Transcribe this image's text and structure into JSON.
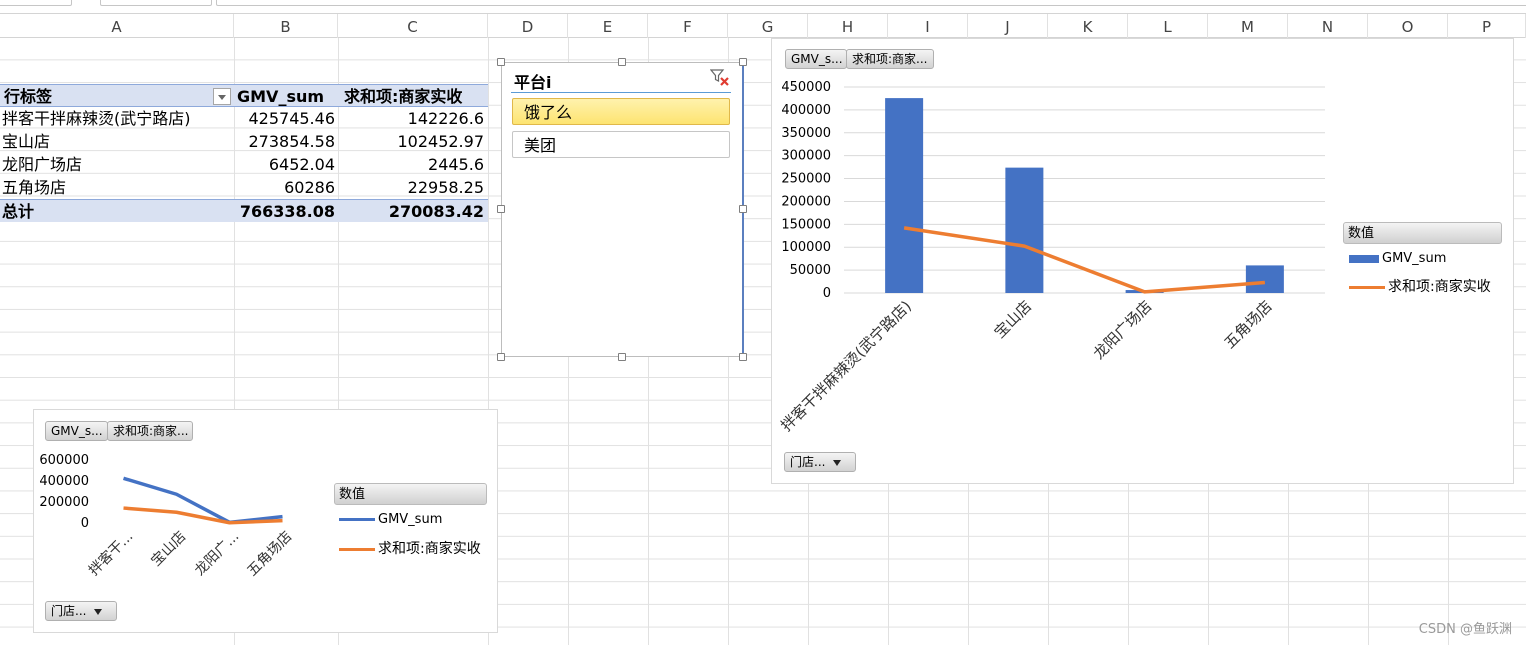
{
  "columns": [
    "A",
    "B",
    "C",
    "D",
    "E",
    "F",
    "G",
    "H",
    "I",
    "J",
    "K",
    "L",
    "M",
    "N",
    "O",
    "P"
  ],
  "pivot": {
    "header": {
      "row_label": "行标签",
      "col_b": "GMV_sum",
      "col_c": "求和项:商家实收"
    },
    "rows": [
      {
        "label": "拌客干拌麻辣烫(武宁路店)",
        "gmv": "425745.46",
        "income": "142226.6"
      },
      {
        "label": "宝山店",
        "gmv": "273854.58",
        "income": "102452.97"
      },
      {
        "label": "龙阳广场店",
        "gmv": "6452.04",
        "income": "2445.6"
      },
      {
        "label": "五角场店",
        "gmv": "60286",
        "income": "22958.25"
      }
    ],
    "total": {
      "label": "总计",
      "gmv": "766338.08",
      "income": "270083.42"
    }
  },
  "slicer": {
    "title": "平台i",
    "items": [
      {
        "label": "饿了么",
        "selected": true
      },
      {
        "label": "美团",
        "selected": false
      }
    ]
  },
  "chart_data": [
    {
      "type": "bar",
      "categories": [
        "拌客干拌麻辣烫(武宁路店)",
        "宝山店",
        "龙阳广场店",
        "五角场店"
      ],
      "series": [
        {
          "name": "GMV_sum",
          "kind": "bar",
          "color": "#4472c4",
          "values": [
            425745.46,
            273854.58,
            6452.04,
            60286
          ]
        },
        {
          "name": "求和项:商家实收",
          "kind": "line",
          "color": "#ed7d31",
          "values": [
            142226.6,
            102452.97,
            2445.6,
            22958.25
          ]
        }
      ],
      "yticks": [
        "450000",
        "400000",
        "350000",
        "300000",
        "250000",
        "200000",
        "150000",
        "100000",
        "50000",
        "0"
      ],
      "ylim": [
        0,
        450000
      ],
      "grid": true,
      "legend_title": "数值",
      "legend_position": "right",
      "field_buttons": [
        "GMV_s...",
        "求和项:商家..."
      ],
      "axis_field_button": "门店..."
    },
    {
      "type": "line",
      "categories": [
        "拌客干...",
        "宝山店",
        "龙阳广...",
        "五角场店"
      ],
      "series": [
        {
          "name": "GMV_sum",
          "color": "#4472c4",
          "values": [
            425745.46,
            273854.58,
            6452.04,
            60286
          ]
        },
        {
          "name": "求和项:商家实收",
          "color": "#ed7d31",
          "values": [
            142226.6,
            102452.97,
            2445.6,
            22958.25
          ]
        }
      ],
      "yticks": [
        "600000",
        "400000",
        "200000",
        "0"
      ],
      "ylim": [
        0,
        600000
      ],
      "grid": false,
      "legend_title": "数值",
      "legend_position": "right",
      "field_buttons": [
        "GMV_s...",
        "求和项:商家..."
      ],
      "axis_field_button": "门店..."
    }
  ],
  "watermark": "CSDN @鱼跃渊"
}
